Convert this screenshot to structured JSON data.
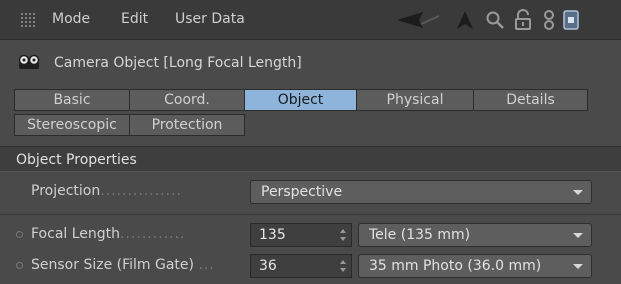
{
  "menu": {
    "items": [
      "Mode",
      "Edit",
      "User Data"
    ]
  },
  "toolbar": {
    "icons": [
      "arrow-left-icon",
      "arrow-up-icon",
      "search-icon",
      "lock-icon",
      "filter-icon",
      "new-panel-icon"
    ]
  },
  "header": {
    "title": "Camera Object [Long Focal Length]",
    "icon": "camera-icon"
  },
  "tabs": [
    {
      "label": "Basic",
      "active": false
    },
    {
      "label": "Coord.",
      "active": false
    },
    {
      "label": "Object",
      "active": true
    },
    {
      "label": "Physical",
      "active": false
    },
    {
      "label": "Details",
      "active": false
    },
    {
      "label": "Stereoscopic",
      "active": false
    },
    {
      "label": "Protection",
      "active": false
    }
  ],
  "section": {
    "title": "Object Properties"
  },
  "fields": {
    "projection": {
      "label": "Projection",
      "dots": "...............",
      "value": "Perspective"
    },
    "focal_length": {
      "label": "Focal Length",
      "dots": "............",
      "value": "135",
      "preset": "Tele (135 mm)"
    },
    "sensor_size": {
      "label": "Sensor Size (Film Gate)",
      "dots": "...",
      "value": "36",
      "preset": "35 mm Photo (36.0 mm)"
    }
  },
  "colors": {
    "accent_tab": "#8eb4dc",
    "background": "#4a4a4a"
  }
}
